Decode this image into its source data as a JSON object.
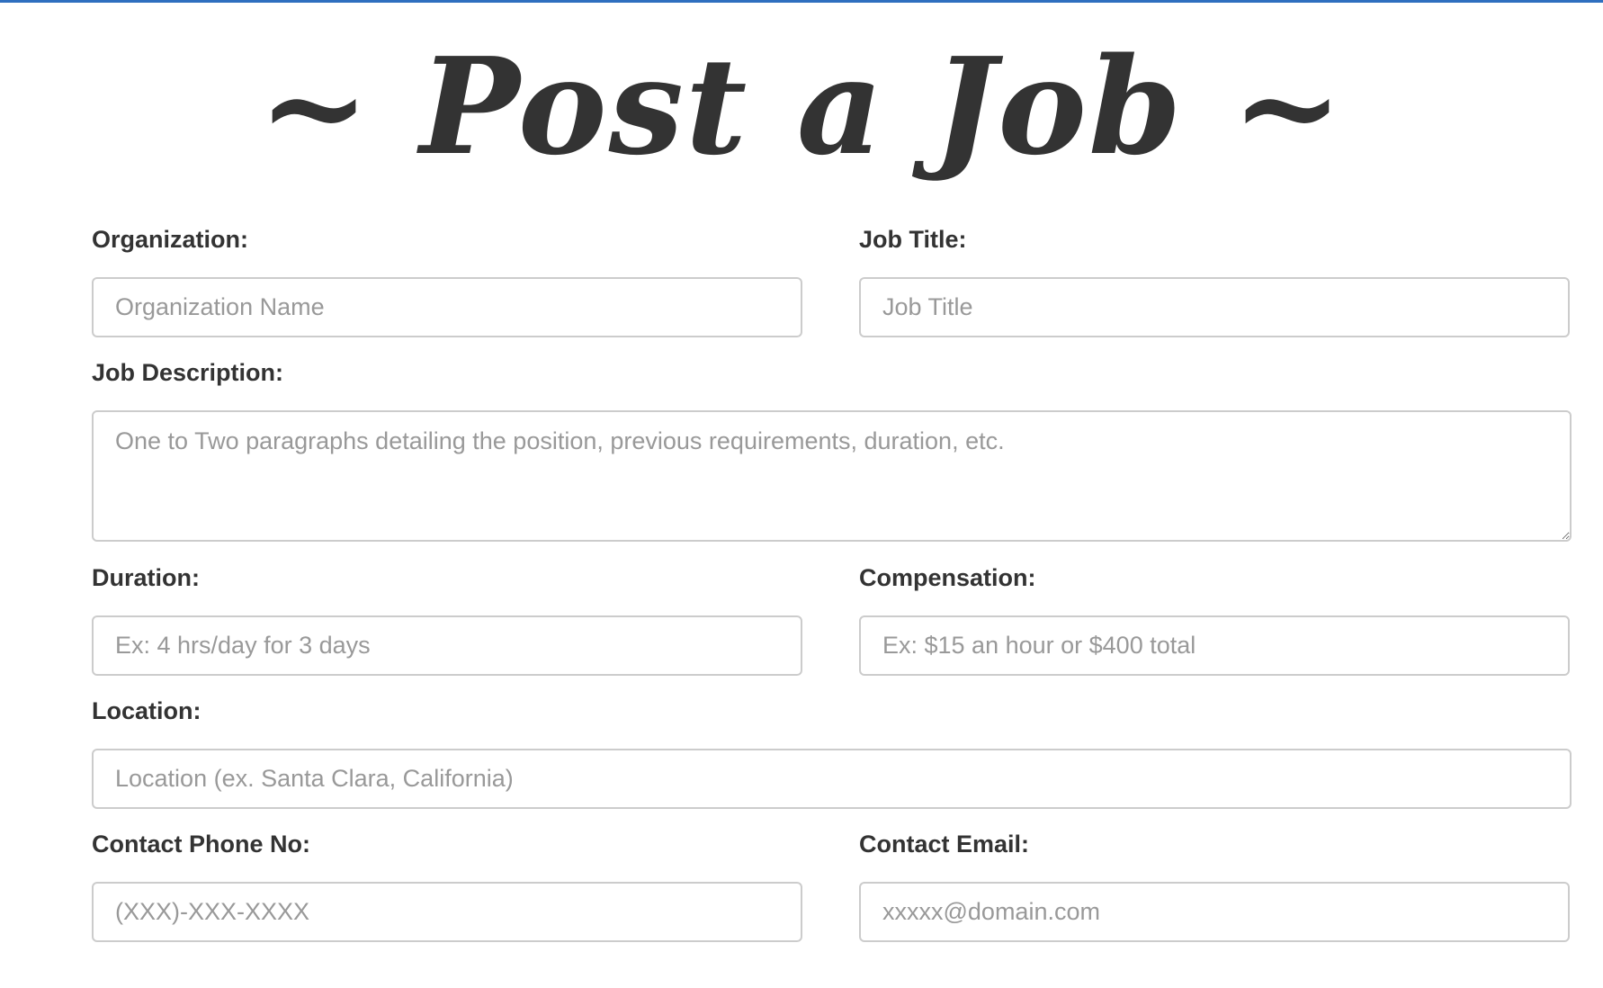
{
  "page": {
    "title": "~ Post a Job ~"
  },
  "form": {
    "organization": {
      "label": "Organization:",
      "placeholder": "Organization Name"
    },
    "job_title": {
      "label": "Job Title:",
      "placeholder": "Job Title"
    },
    "job_description": {
      "label": "Job Description:",
      "placeholder": "One to Two paragraphs detailing the position, previous requirements, duration, etc."
    },
    "duration": {
      "label": "Duration:",
      "placeholder": "Ex: 4 hrs/day for 3 days"
    },
    "compensation": {
      "label": "Compensation:",
      "placeholder": "Ex: $15 an hour or $400 total"
    },
    "location": {
      "label": "Location:",
      "placeholder": "Location (ex. Santa Clara, California)"
    },
    "contact_phone": {
      "label": "Contact Phone No:",
      "placeholder": "(XXX)-XXX-XXXX"
    },
    "contact_email": {
      "label": "Contact Email:",
      "placeholder": "xxxxx@domain.com"
    }
  },
  "colors": {
    "top_rule": "#2f6fbf",
    "text": "#333333",
    "placeholder": "#999999",
    "input_border": "#cccccc"
  }
}
